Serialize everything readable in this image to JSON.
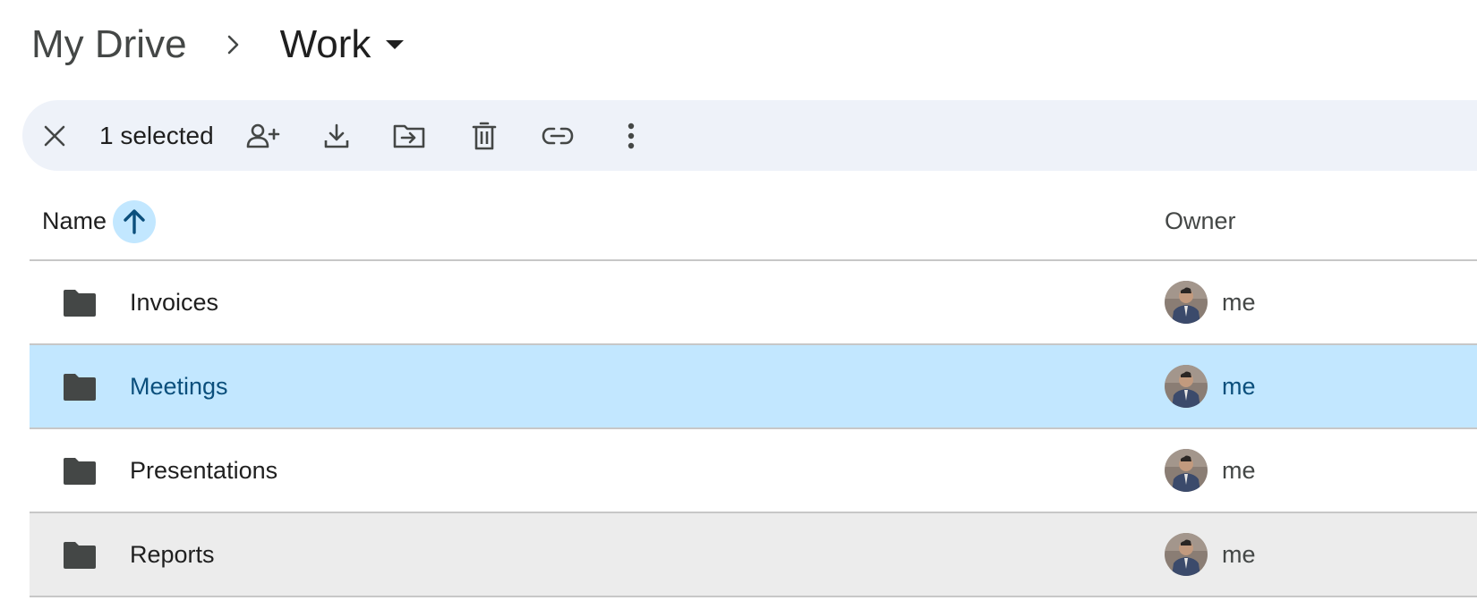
{
  "breadcrumb": {
    "root": "My Drive",
    "current": "Work",
    "separator_icon": "chevron-right-icon",
    "caret_icon": "arrow-drop-down-icon"
  },
  "toolbar": {
    "selected_count": "1 selected",
    "actions": [
      {
        "name": "clear-selection",
        "icon": "close-icon"
      },
      {
        "name": "share",
        "icon": "person-add-icon"
      },
      {
        "name": "download",
        "icon": "download-icon"
      },
      {
        "name": "move",
        "icon": "drive-file-move-icon"
      },
      {
        "name": "move-to-trash",
        "icon": "trash-icon"
      },
      {
        "name": "copy-link",
        "icon": "link-icon"
      },
      {
        "name": "more-actions",
        "icon": "more-vert-icon"
      }
    ]
  },
  "table": {
    "columns": {
      "name": "Name",
      "owner": "Owner"
    },
    "sort": {
      "column": "Name",
      "direction": "ascending",
      "icon": "arrow-upward-icon"
    },
    "rows": [
      {
        "name": "Invoices",
        "owner": "me",
        "type": "folder",
        "state": "normal"
      },
      {
        "name": "Meetings",
        "owner": "me",
        "type": "folder",
        "state": "selected"
      },
      {
        "name": "Presentations",
        "owner": "me",
        "type": "folder",
        "state": "normal"
      },
      {
        "name": "Reports",
        "owner": "me",
        "type": "folder",
        "state": "hovered"
      }
    ]
  },
  "colors": {
    "accent_selected_bg": "#c2e7ff",
    "selected_text": "#0b4f7c",
    "toolbar_bg": "#eef2f9",
    "hover_bg": "#ececec",
    "folder_icon": "#444746"
  }
}
